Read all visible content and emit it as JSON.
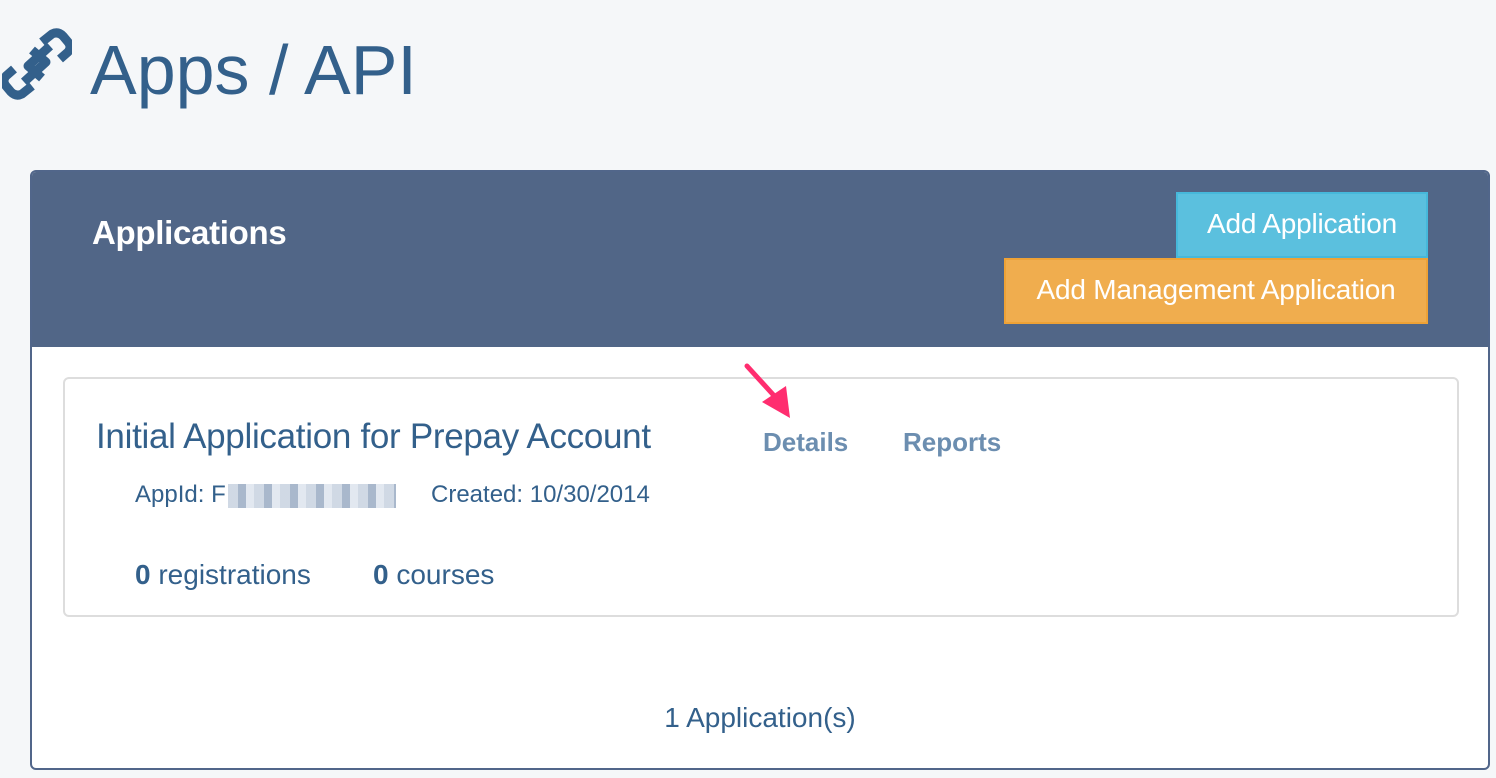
{
  "page": {
    "title": "Apps / API",
    "icon": "link-icon",
    "title_color": "#33608b",
    "background": "#f5f7f9"
  },
  "panel": {
    "title": "Applications",
    "header_color": "#516687",
    "buttons": {
      "add_application": {
        "label": "Add Application",
        "color": "#5bc0de"
      },
      "add_management_application": {
        "label": "Add Management Application",
        "color": "#f0ad4e"
      }
    }
  },
  "applications": [
    {
      "name": "Initial Application for Prepay Account",
      "links": {
        "details": "Details",
        "reports": "Reports"
      },
      "appid_label": "AppId:",
      "appid_visible_prefix": "F",
      "appid_redacted": true,
      "created_label": "Created:",
      "created_date": "10/30/2014",
      "registrations_count": "0",
      "registrations_label": "registrations",
      "courses_count": "0",
      "courses_label": "courses"
    }
  ],
  "footer": {
    "count_text": "1 Application(s)"
  },
  "annotation": {
    "arrow_color": "#ff2d6f",
    "points_to": "Details"
  }
}
